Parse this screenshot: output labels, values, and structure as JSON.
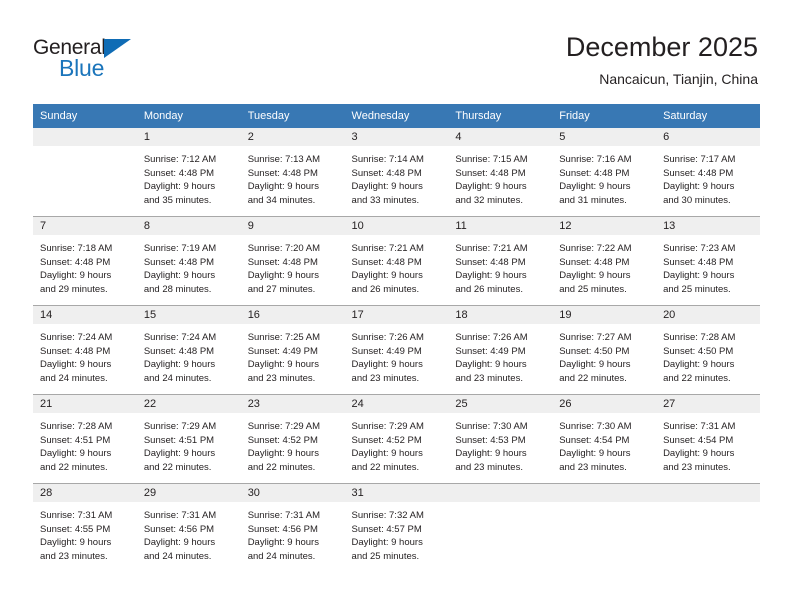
{
  "brand": {
    "name_top": "General",
    "name_bottom": "Blue",
    "accent_color": "#1b75bb",
    "triangle_color": "#0f6cb5"
  },
  "header": {
    "title": "December 2025",
    "location": "Nancaicun, Tianjin, China"
  },
  "calendar": {
    "header_bg": "#3878b4",
    "daynum_bg": "#efefef",
    "weekday_headers": [
      "Sunday",
      "Monday",
      "Tuesday",
      "Wednesday",
      "Thursday",
      "Friday",
      "Saturday"
    ],
    "weeks": [
      [
        {
          "day": "",
          "sunrise": "",
          "sunset": "",
          "daylight_1": "",
          "daylight_2": ""
        },
        {
          "day": "1",
          "sunrise": "Sunrise: 7:12 AM",
          "sunset": "Sunset: 4:48 PM",
          "daylight_1": "Daylight: 9 hours",
          "daylight_2": "and 35 minutes."
        },
        {
          "day": "2",
          "sunrise": "Sunrise: 7:13 AM",
          "sunset": "Sunset: 4:48 PM",
          "daylight_1": "Daylight: 9 hours",
          "daylight_2": "and 34 minutes."
        },
        {
          "day": "3",
          "sunrise": "Sunrise: 7:14 AM",
          "sunset": "Sunset: 4:48 PM",
          "daylight_1": "Daylight: 9 hours",
          "daylight_2": "and 33 minutes."
        },
        {
          "day": "4",
          "sunrise": "Sunrise: 7:15 AM",
          "sunset": "Sunset: 4:48 PM",
          "daylight_1": "Daylight: 9 hours",
          "daylight_2": "and 32 minutes."
        },
        {
          "day": "5",
          "sunrise": "Sunrise: 7:16 AM",
          "sunset": "Sunset: 4:48 PM",
          "daylight_1": "Daylight: 9 hours",
          "daylight_2": "and 31 minutes."
        },
        {
          "day": "6",
          "sunrise": "Sunrise: 7:17 AM",
          "sunset": "Sunset: 4:48 PM",
          "daylight_1": "Daylight: 9 hours",
          "daylight_2": "and 30 minutes."
        }
      ],
      [
        {
          "day": "7",
          "sunrise": "Sunrise: 7:18 AM",
          "sunset": "Sunset: 4:48 PM",
          "daylight_1": "Daylight: 9 hours",
          "daylight_2": "and 29 minutes."
        },
        {
          "day": "8",
          "sunrise": "Sunrise: 7:19 AM",
          "sunset": "Sunset: 4:48 PM",
          "daylight_1": "Daylight: 9 hours",
          "daylight_2": "and 28 minutes."
        },
        {
          "day": "9",
          "sunrise": "Sunrise: 7:20 AM",
          "sunset": "Sunset: 4:48 PM",
          "daylight_1": "Daylight: 9 hours",
          "daylight_2": "and 27 minutes."
        },
        {
          "day": "10",
          "sunrise": "Sunrise: 7:21 AM",
          "sunset": "Sunset: 4:48 PM",
          "daylight_1": "Daylight: 9 hours",
          "daylight_2": "and 26 minutes."
        },
        {
          "day": "11",
          "sunrise": "Sunrise: 7:21 AM",
          "sunset": "Sunset: 4:48 PM",
          "daylight_1": "Daylight: 9 hours",
          "daylight_2": "and 26 minutes."
        },
        {
          "day": "12",
          "sunrise": "Sunrise: 7:22 AM",
          "sunset": "Sunset: 4:48 PM",
          "daylight_1": "Daylight: 9 hours",
          "daylight_2": "and 25 minutes."
        },
        {
          "day": "13",
          "sunrise": "Sunrise: 7:23 AM",
          "sunset": "Sunset: 4:48 PM",
          "daylight_1": "Daylight: 9 hours",
          "daylight_2": "and 25 minutes."
        }
      ],
      [
        {
          "day": "14",
          "sunrise": "Sunrise: 7:24 AM",
          "sunset": "Sunset: 4:48 PM",
          "daylight_1": "Daylight: 9 hours",
          "daylight_2": "and 24 minutes."
        },
        {
          "day": "15",
          "sunrise": "Sunrise: 7:24 AM",
          "sunset": "Sunset: 4:48 PM",
          "daylight_1": "Daylight: 9 hours",
          "daylight_2": "and 24 minutes."
        },
        {
          "day": "16",
          "sunrise": "Sunrise: 7:25 AM",
          "sunset": "Sunset: 4:49 PM",
          "daylight_1": "Daylight: 9 hours",
          "daylight_2": "and 23 minutes."
        },
        {
          "day": "17",
          "sunrise": "Sunrise: 7:26 AM",
          "sunset": "Sunset: 4:49 PM",
          "daylight_1": "Daylight: 9 hours",
          "daylight_2": "and 23 minutes."
        },
        {
          "day": "18",
          "sunrise": "Sunrise: 7:26 AM",
          "sunset": "Sunset: 4:49 PM",
          "daylight_1": "Daylight: 9 hours",
          "daylight_2": "and 23 minutes."
        },
        {
          "day": "19",
          "sunrise": "Sunrise: 7:27 AM",
          "sunset": "Sunset: 4:50 PM",
          "daylight_1": "Daylight: 9 hours",
          "daylight_2": "and 22 minutes."
        },
        {
          "day": "20",
          "sunrise": "Sunrise: 7:28 AM",
          "sunset": "Sunset: 4:50 PM",
          "daylight_1": "Daylight: 9 hours",
          "daylight_2": "and 22 minutes."
        }
      ],
      [
        {
          "day": "21",
          "sunrise": "Sunrise: 7:28 AM",
          "sunset": "Sunset: 4:51 PM",
          "daylight_1": "Daylight: 9 hours",
          "daylight_2": "and 22 minutes."
        },
        {
          "day": "22",
          "sunrise": "Sunrise: 7:29 AM",
          "sunset": "Sunset: 4:51 PM",
          "daylight_1": "Daylight: 9 hours",
          "daylight_2": "and 22 minutes."
        },
        {
          "day": "23",
          "sunrise": "Sunrise: 7:29 AM",
          "sunset": "Sunset: 4:52 PM",
          "daylight_1": "Daylight: 9 hours",
          "daylight_2": "and 22 minutes."
        },
        {
          "day": "24",
          "sunrise": "Sunrise: 7:29 AM",
          "sunset": "Sunset: 4:52 PM",
          "daylight_1": "Daylight: 9 hours",
          "daylight_2": "and 22 minutes."
        },
        {
          "day": "25",
          "sunrise": "Sunrise: 7:30 AM",
          "sunset": "Sunset: 4:53 PM",
          "daylight_1": "Daylight: 9 hours",
          "daylight_2": "and 23 minutes."
        },
        {
          "day": "26",
          "sunrise": "Sunrise: 7:30 AM",
          "sunset": "Sunset: 4:54 PM",
          "daylight_1": "Daylight: 9 hours",
          "daylight_2": "and 23 minutes."
        },
        {
          "day": "27",
          "sunrise": "Sunrise: 7:31 AM",
          "sunset": "Sunset: 4:54 PM",
          "daylight_1": "Daylight: 9 hours",
          "daylight_2": "and 23 minutes."
        }
      ],
      [
        {
          "day": "28",
          "sunrise": "Sunrise: 7:31 AM",
          "sunset": "Sunset: 4:55 PM",
          "daylight_1": "Daylight: 9 hours",
          "daylight_2": "and 23 minutes."
        },
        {
          "day": "29",
          "sunrise": "Sunrise: 7:31 AM",
          "sunset": "Sunset: 4:56 PM",
          "daylight_1": "Daylight: 9 hours",
          "daylight_2": "and 24 minutes."
        },
        {
          "day": "30",
          "sunrise": "Sunrise: 7:31 AM",
          "sunset": "Sunset: 4:56 PM",
          "daylight_1": "Daylight: 9 hours",
          "daylight_2": "and 24 minutes."
        },
        {
          "day": "31",
          "sunrise": "Sunrise: 7:32 AM",
          "sunset": "Sunset: 4:57 PM",
          "daylight_1": "Daylight: 9 hours",
          "daylight_2": "and 25 minutes."
        },
        {
          "day": "",
          "sunrise": "",
          "sunset": "",
          "daylight_1": "",
          "daylight_2": ""
        },
        {
          "day": "",
          "sunrise": "",
          "sunset": "",
          "daylight_1": "",
          "daylight_2": ""
        },
        {
          "day": "",
          "sunrise": "",
          "sunset": "",
          "daylight_1": "",
          "daylight_2": ""
        }
      ]
    ]
  }
}
